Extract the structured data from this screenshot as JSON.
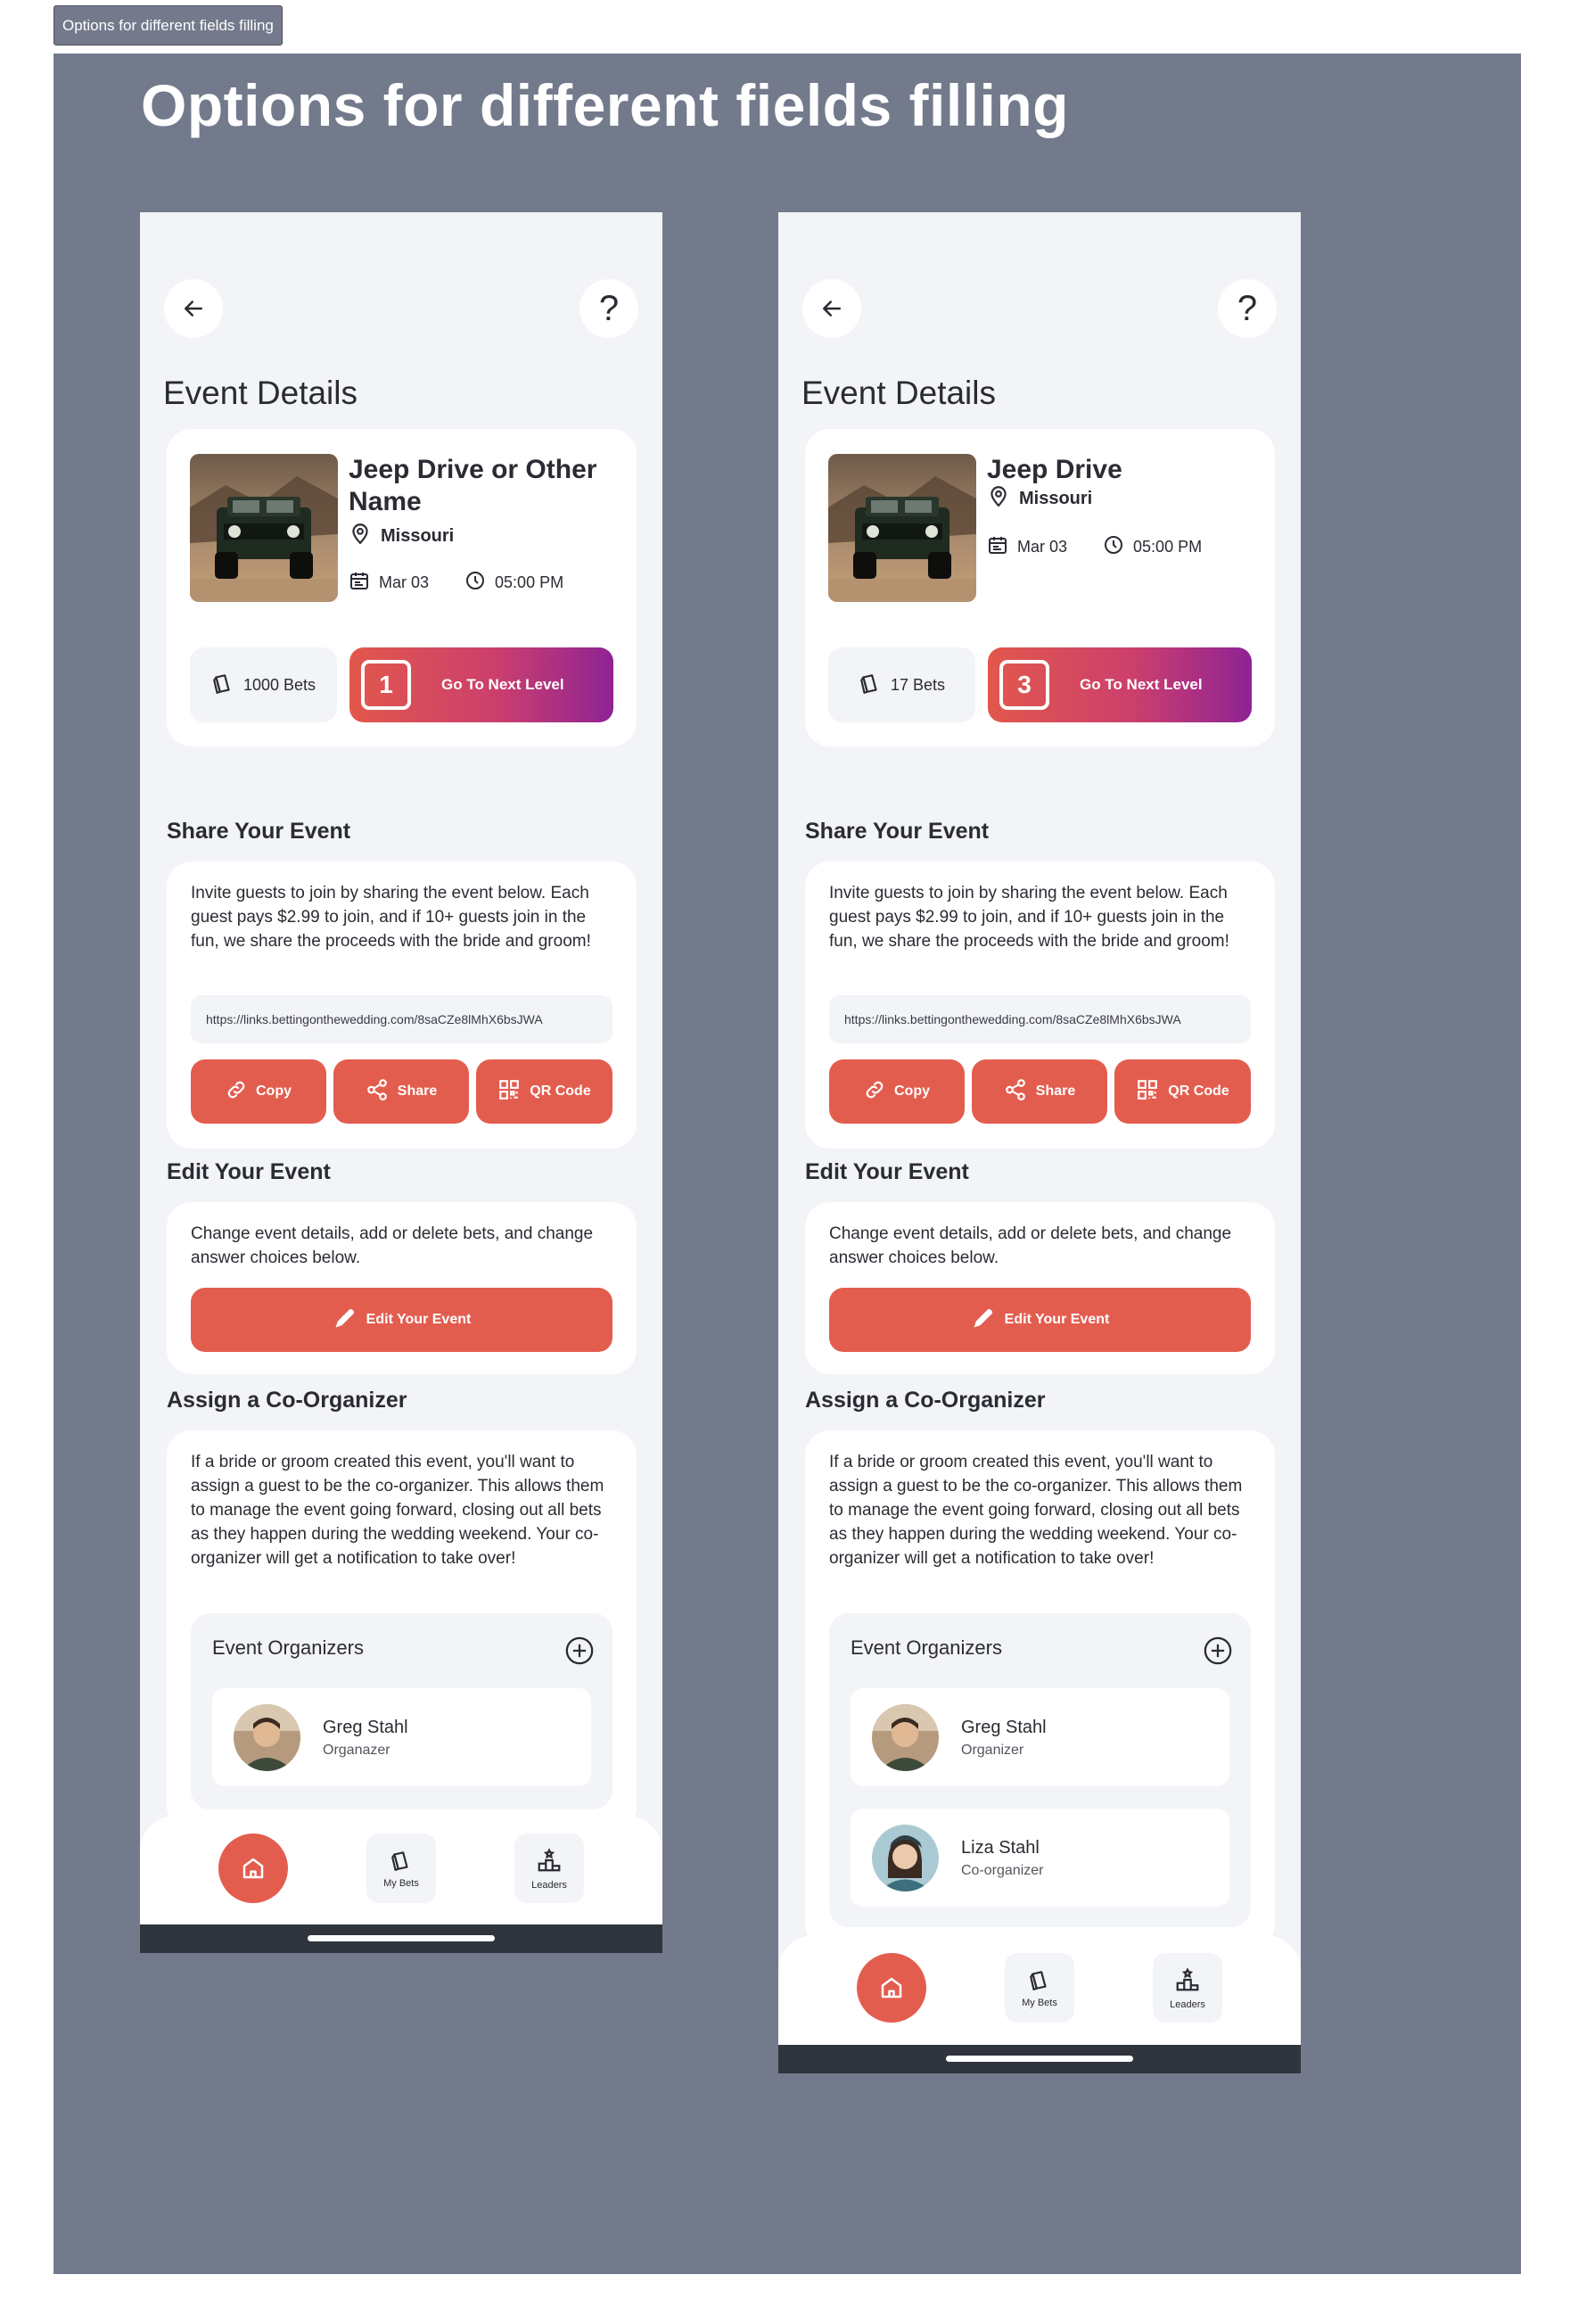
{
  "frame_label": "Options for different fields filling",
  "heading": "Options for different fields filling",
  "brand_colors": {
    "accent": "#e35d4f",
    "gradient_end": "#8e2394",
    "canvas": "#737a8c"
  },
  "phones": [
    {
      "page_title": "Event Details",
      "event": {
        "name": "Jeep Drive or Other Name",
        "location": "Missouri",
        "date": "Mar 03",
        "time": "05:00 PM",
        "bets": "1000 Bets",
        "level": "1",
        "next_level_label": "Go To Next Level"
      },
      "share": {
        "title": "Share Your Event",
        "description": "Invite guests to join by sharing the event below. Each guest pays $2.99 to join, and if 10+ guests join in the fun, we share the proceeds with the bride and groom!",
        "link": "https://links.bettingonthewedding.com/8saCZe8lMhX6bsJWA",
        "copy_label": "Copy",
        "share_label": "Share",
        "qr_label": "QR Code"
      },
      "edit": {
        "title": "Edit Your Event",
        "description": "Change event details, add or delete bets, and change answer choices below.",
        "button_label": "Edit Your Event"
      },
      "coorganizer": {
        "title": "Assign a Co-Organizer",
        "description": "If a bride or groom created this event, you'll want to assign a guest to be the co-organizer. This allows them to manage the event going forward, closing out all bets as they happen during the wedding weekend. Your co-organizer will get a notification to take over!",
        "organizers_label": "Event Organizers",
        "organizers": [
          {
            "name": "Greg Stahl",
            "role": "Organazer"
          }
        ]
      },
      "tabbar": {
        "my_bets": "My Bets",
        "leaders": "Leaders"
      }
    },
    {
      "page_title": "Event Details",
      "event": {
        "name": "Jeep Drive",
        "location": "Missouri",
        "date": "Mar 03",
        "time": "05:00 PM",
        "bets": "17 Bets",
        "level": "3",
        "next_level_label": "Go To Next Level"
      },
      "share": {
        "title": "Share Your Event",
        "description": "Invite guests to join by sharing the event below. Each guest pays $2.99 to join, and if 10+ guests join in the fun, we share the proceeds with the bride and groom!",
        "link": "https://links.bettingonthewedding.com/8saCZe8lMhX6bsJWA",
        "copy_label": "Copy",
        "share_label": "Share",
        "qr_label": "QR Code"
      },
      "edit": {
        "title": "Edit Your Event",
        "description": "Change event details, add or delete bets, and change answer choices below.",
        "button_label": "Edit Your Event"
      },
      "coorganizer": {
        "title": "Assign a Co-Organizer",
        "description": "If a bride or groom created this event, you'll want to assign a guest to be the co-organizer. This allows them to manage the event going forward, closing out all bets as they happen during the wedding weekend. Your co-organizer will get a notification to take over!",
        "organizers_label": "Event Organizers",
        "organizers": [
          {
            "name": "Greg Stahl",
            "role": "Organizer"
          },
          {
            "name": "Liza Stahl",
            "role": "Co-organizer"
          }
        ]
      },
      "tabbar": {
        "my_bets": "My Bets",
        "leaders": "Leaders"
      }
    }
  ]
}
